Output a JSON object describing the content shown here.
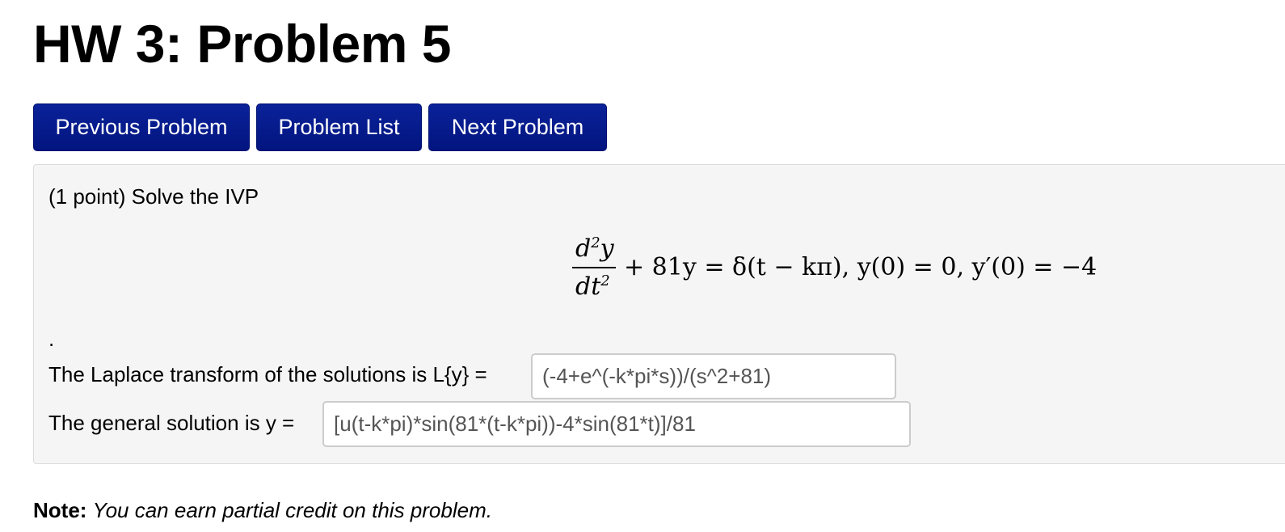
{
  "page": {
    "title": "HW 3: Problem 5"
  },
  "nav": {
    "previous_label": "Previous Problem",
    "list_label": "Problem List",
    "next_label": "Next Problem"
  },
  "problem": {
    "intro": "(1 point) Solve the IVP",
    "equation": {
      "numerator_base": "d",
      "numerator_exp": "2",
      "numerator_var": "y",
      "denominator_base": "dt",
      "denominator_exp": "2",
      "rest": "+ 81y = δ(t − kπ), y(0) = 0, y′(0) = −4"
    },
    "period": ".",
    "laplace_label": "The Laplace transform of the solutions is L{y} =",
    "laplace_value": "(-4+e^(-k*pi*s))/(s^2+81)",
    "general_label": "The general solution is y =",
    "general_value": "[u(t-k*pi)*sin(81*(t-k*pi))-4*sin(81*t)]/81"
  },
  "note": {
    "label": "Note:",
    "message": "You can earn partial credit on this problem."
  }
}
